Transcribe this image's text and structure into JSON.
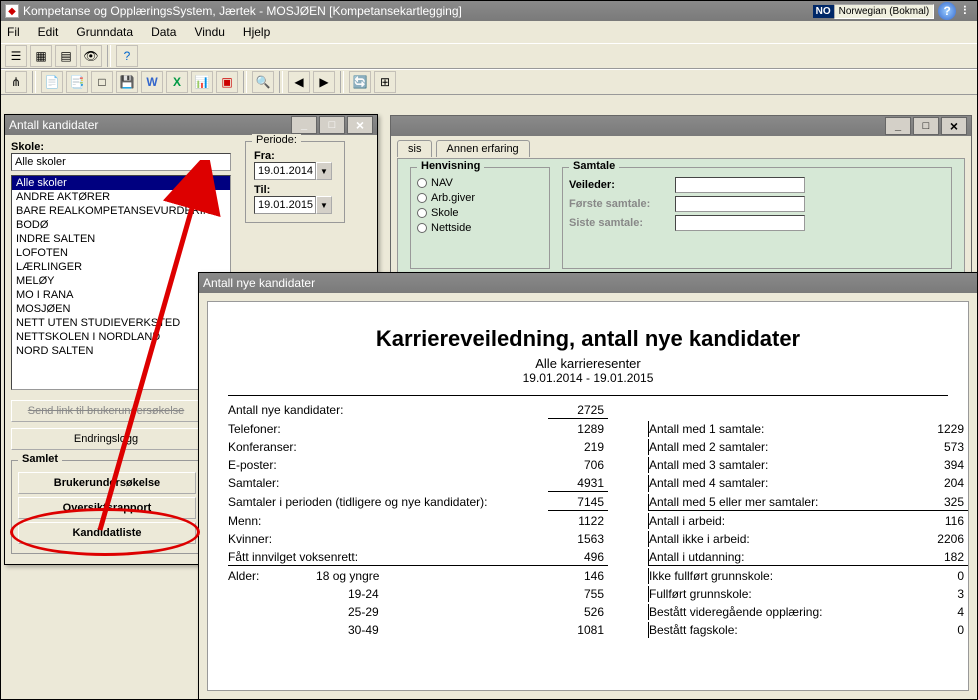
{
  "app": {
    "title": "Kompetanse og OpplæringsSystem, Jærtek - MOSJØEN [Kompetansekartlegging]",
    "lang_code": "NO",
    "lang_name": "Norwegian (Bokmal)"
  },
  "menu": {
    "fil": "Fil",
    "edit": "Edit",
    "grunndata": "Grunndata",
    "data": "Data",
    "vindu": "Vindu",
    "hjelp": "Hjelp"
  },
  "bg_window": {
    "tab1": "sis",
    "tab2": "Annen erfaring",
    "henvisning": {
      "legend": "Henvisning",
      "nav": "NAV",
      "arbgiver": "Arb.giver",
      "skole": "Skole",
      "nettside": "Nettside"
    },
    "samtale": {
      "legend": "Samtale",
      "veileder": "Veileder:",
      "forste": "Første samtale:",
      "siste": "Siste samtale:"
    }
  },
  "ak_window": {
    "title": "Antall kandidater",
    "skole_label": "Skole:",
    "skole_value": "Alle skoler",
    "list": [
      "Alle skoler",
      "ANDRE AKTØRER",
      "BARE REALKOMPETANSEVURDERING",
      "BODØ",
      "INDRE SALTEN",
      "LOFOTEN",
      "LÆRLINGER",
      "MELØY",
      "MO I RANA",
      "MOSJØEN",
      "NETT UTEN STUDIEVERKSTED",
      "NETTSKOLEN I NORDLAND",
      "NORD SALTEN"
    ],
    "periode": {
      "legend": "Periode:",
      "fra": "Fra:",
      "fra_val": "19.01.2014",
      "til": "Til:",
      "til_val": "19.01.2015"
    },
    "btn_send": "Send link til brukerundersøkelse",
    "btn_log": "Endringslogg",
    "samlet": "Samlet",
    "btn_bruker": "Brukerundersøkelse",
    "btn_oversikt": "Oversiktsrapport",
    "btn_kandidat": "Kandidatliste"
  },
  "report": {
    "win_title": "Antall nye kandidater",
    "title": "Karriereveiledning, antall nye kandidater",
    "subtitle": "Alle karrieresenter",
    "range": "19.01.2014 - 19.01.2015",
    "left": {
      "antall_nye": {
        "l": "Antall nye kandidater:",
        "v": "2725"
      },
      "telefoner": {
        "l": "Telefoner:",
        "v": "1289"
      },
      "konferanser": {
        "l": "Konferanser:",
        "v": "219"
      },
      "eposter": {
        "l": "E-poster:",
        "v": "706"
      },
      "samtaler": {
        "l": "Samtaler:",
        "v": "4931"
      },
      "samtaler_per": {
        "l": "Samtaler i perioden (tidligere og nye kandidater):",
        "v": "7145"
      },
      "menn": {
        "l": "Menn:",
        "v": "1122"
      },
      "kvinner": {
        "l": "Kvinner:",
        "v": "1563"
      },
      "voksenrett": {
        "l": "Fått innvilget voksenrett:",
        "v": "496"
      },
      "alder": "Alder:",
      "a18": {
        "l": "18 og yngre",
        "v": "146"
      },
      "a1924": {
        "l": "19-24",
        "v": "755"
      },
      "a2529": {
        "l": "25-29",
        "v": "526"
      },
      "a3049": {
        "l": "30-49",
        "v": "1081"
      }
    },
    "right": {
      "s1": {
        "l": "Antall med 1 samtale:",
        "v": "1229"
      },
      "s2": {
        "l": "Antall med 2 samtaler:",
        "v": "573"
      },
      "s3": {
        "l": "Antall med 3 samtaler:",
        "v": "394"
      },
      "s4": {
        "l": "Antall med 4 samtaler:",
        "v": "204"
      },
      "s5": {
        "l": "Antall med 5 eller mer samtaler:",
        "v": "325"
      },
      "arbeid": {
        "l": "Antall i arbeid:",
        "v": "116"
      },
      "ikkearbeid": {
        "l": "Antall ikke i arbeid:",
        "v": "2206"
      },
      "utdanning": {
        "l": "Antall i utdanning:",
        "v": "182"
      },
      "ikke_gs": {
        "l": "Ikke fullført grunnskole:",
        "v": "0"
      },
      "full_gs": {
        "l": "Fullført grunnskole:",
        "v": "3"
      },
      "vgo": {
        "l": "Bestått videregående opplæring:",
        "v": "4"
      },
      "fagskole": {
        "l": "Bestått fagskole:",
        "v": "0"
      }
    }
  }
}
